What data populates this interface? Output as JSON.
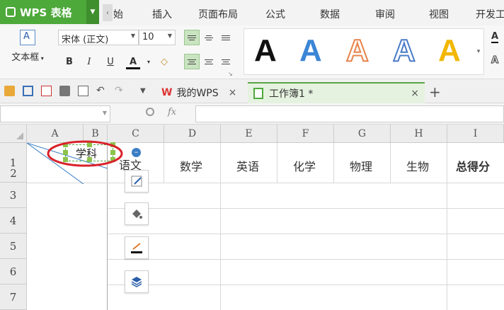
{
  "app": {
    "name": "WPS 表格"
  },
  "menu": {
    "partial_first": "始",
    "items": [
      "插入",
      "页面布局",
      "公式",
      "数据",
      "审阅",
      "视图",
      "开发工"
    ]
  },
  "ribbon": {
    "textbox_label": "文本框",
    "font_name": "宋体 (正文)",
    "font_size": "10",
    "bold": "B",
    "italic": "I",
    "underline": "U",
    "font_color": "A",
    "wordart_letter": "A",
    "wordart_colors": [
      "#111111",
      "#3b86d6",
      "#e8834a",
      "#4a7bc8",
      "#f2b705"
    ]
  },
  "tabs": [
    {
      "label": "我的WPS",
      "close": "×"
    },
    {
      "label": "工作簿1 *",
      "close": "×"
    }
  ],
  "new_tab": "+",
  "formula_bar": {
    "fx": "fx"
  },
  "grid": {
    "columns": [
      "A",
      "B",
      "C",
      "D",
      "E",
      "F",
      "G",
      "H",
      "I"
    ],
    "rows": [
      "1",
      "2",
      "3",
      "4",
      "5",
      "6",
      "7"
    ],
    "cells": {
      "b1_textbox": "学科",
      "c1": "语文",
      "d1": "数学",
      "e1": "英语",
      "f1": "化学",
      "g1": "物理",
      "h1": "生物",
      "i1": "总得分"
    }
  },
  "colors": {
    "accent": "#4ea93b",
    "annotation": "#d9222a"
  }
}
